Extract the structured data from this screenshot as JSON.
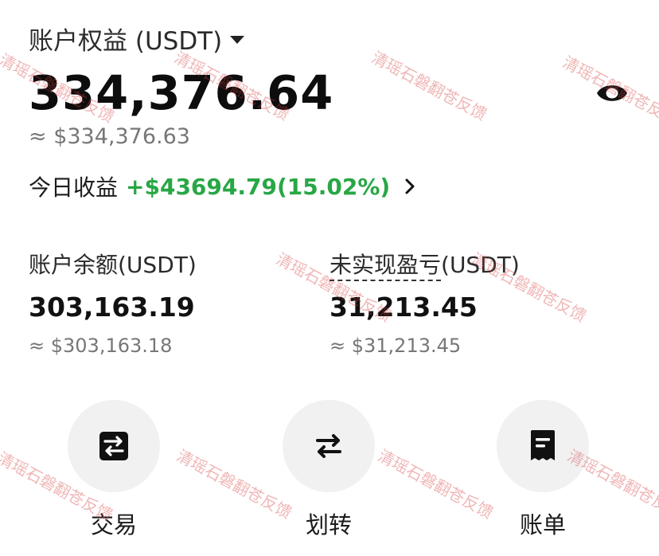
{
  "header": {
    "equity_label": "账户权益 (USDT)",
    "equity_value": "334,376.64",
    "equity_approx": "≈ $334,376.63"
  },
  "today": {
    "label": "今日收益",
    "pnl": "+$43694.79(15.02%)"
  },
  "stats": {
    "balance": {
      "label": "账户余额(USDT)",
      "value": "303,163.19",
      "approx": "≈ $303,163.18"
    },
    "unrealized": {
      "label": "未实现盈亏",
      "label_suffix": "(USDT)",
      "value": "31,213.45",
      "approx": "≈ $31,213.45"
    }
  },
  "actions": [
    {
      "label": "交易",
      "icon": "trade-icon"
    },
    {
      "label": "划转",
      "icon": "transfer-icon"
    },
    {
      "label": "账单",
      "icon": "bill-icon"
    }
  ],
  "watermark": "清瑶石磐翻苍反馈",
  "colors": {
    "positive": "#28a745",
    "text_primary": "#111111",
    "text_secondary": "#777777",
    "action_bg": "#f1f1f1"
  }
}
